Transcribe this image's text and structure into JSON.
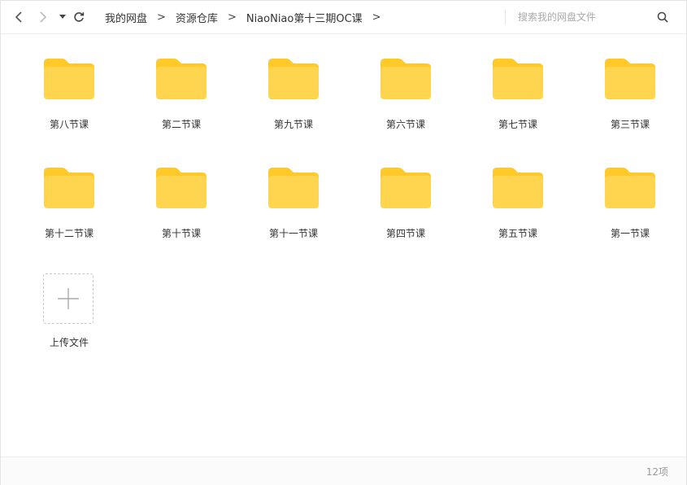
{
  "toolbar": {
    "back_icon": "chevron-left-icon",
    "forward_icon": "chevron-right-icon",
    "history_icon": "caret-down-icon",
    "refresh_icon": "refresh-icon",
    "breadcrumb": [
      "我的网盘",
      "资源仓库",
      "NiaoNiao第十三期OC课"
    ],
    "separator": ">"
  },
  "search": {
    "placeholder": "搜索我的网盘文件",
    "icon": "search-icon"
  },
  "folders": [
    {
      "name": "第八节课"
    },
    {
      "name": "第二节课"
    },
    {
      "name": "第九节课"
    },
    {
      "name": "第六节课"
    },
    {
      "name": "第七节课"
    },
    {
      "name": "第三节课"
    },
    {
      "name": "第十二节课"
    },
    {
      "name": "第十节课"
    },
    {
      "name": "第十一节课"
    },
    {
      "name": "第四节课"
    },
    {
      "name": "第五节课"
    },
    {
      "name": "第一节课"
    }
  ],
  "upload": {
    "label": "上传文件",
    "icon": "plus-icon"
  },
  "footer": {
    "item_count": "12项"
  },
  "colors": {
    "folder_body": "#ffd54f",
    "folder_tab": "#ffca28",
    "accent": "#06a7ff"
  }
}
